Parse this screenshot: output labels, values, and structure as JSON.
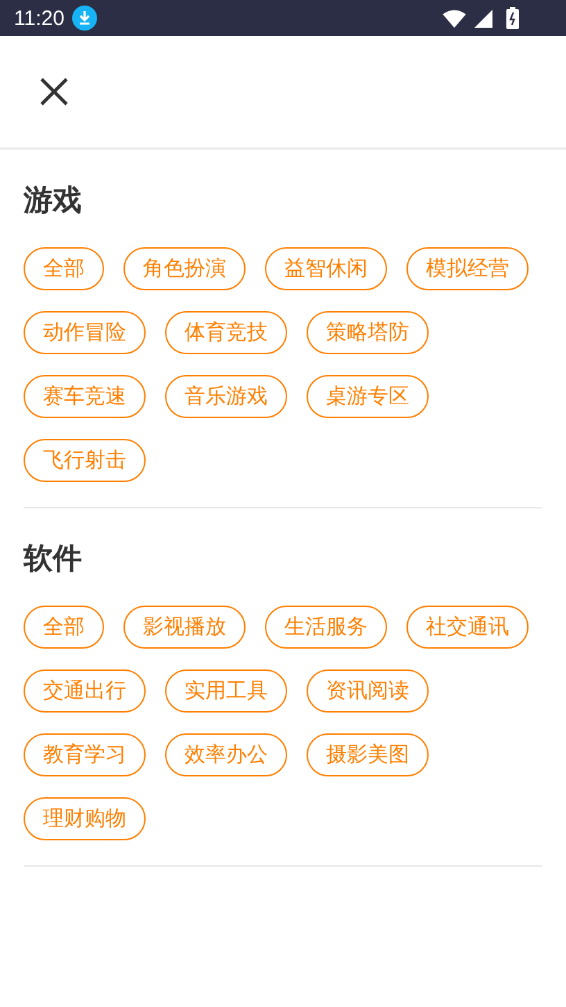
{
  "status_bar": {
    "time": "11:20"
  },
  "sections": [
    {
      "title": "游戏",
      "tags": [
        "全部",
        "角色扮演",
        "益智休闲",
        "模拟经营",
        "动作冒险",
        "体育竞技",
        "策略塔防",
        "赛车竞速",
        "音乐游戏",
        "桌游专区",
        "飞行射击"
      ]
    },
    {
      "title": "软件",
      "tags": [
        "全部",
        "影视播放",
        "生活服务",
        "社交通讯",
        "交通出行",
        "实用工具",
        "资讯阅读",
        "教育学习",
        "效率办公",
        "摄影美图",
        "理财购物"
      ]
    }
  ]
}
